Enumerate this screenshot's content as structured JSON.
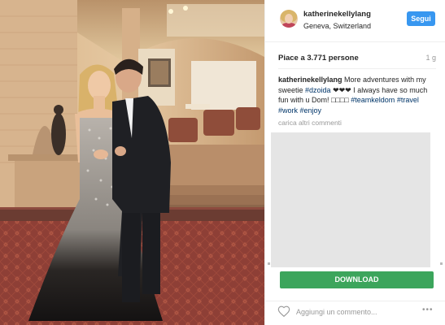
{
  "post": {
    "username": "katherinekellylang",
    "location": "Geneva, Switzerland",
    "follow_label": "Segui",
    "likes": "Piace a 3.771 persone",
    "time": "1 g",
    "caption": {
      "username": "katherinekellylang",
      "text_before": " More adventures with my sweetie ",
      "tag1": "#dzoida",
      "text_middle": " ❤❤❤ I always have so much fun with u Dom! □□□□ ",
      "tag2": "#teamkeldom",
      "tag3": "#travel",
      "tag4": "#work",
      "tag5": "#enjoy"
    },
    "load_more": "carica altri commenti",
    "comment_placeholder": "Aggiungi un commento...",
    "more_icon": "•••"
  },
  "ad": {
    "download_label": "DOWNLOAD"
  },
  "colors": {
    "follow": "#3897f0",
    "download": "#3ca55c",
    "hashtag": "#003569"
  },
  "icons": {
    "heart": "heart-icon",
    "more": "more-options-icon"
  }
}
